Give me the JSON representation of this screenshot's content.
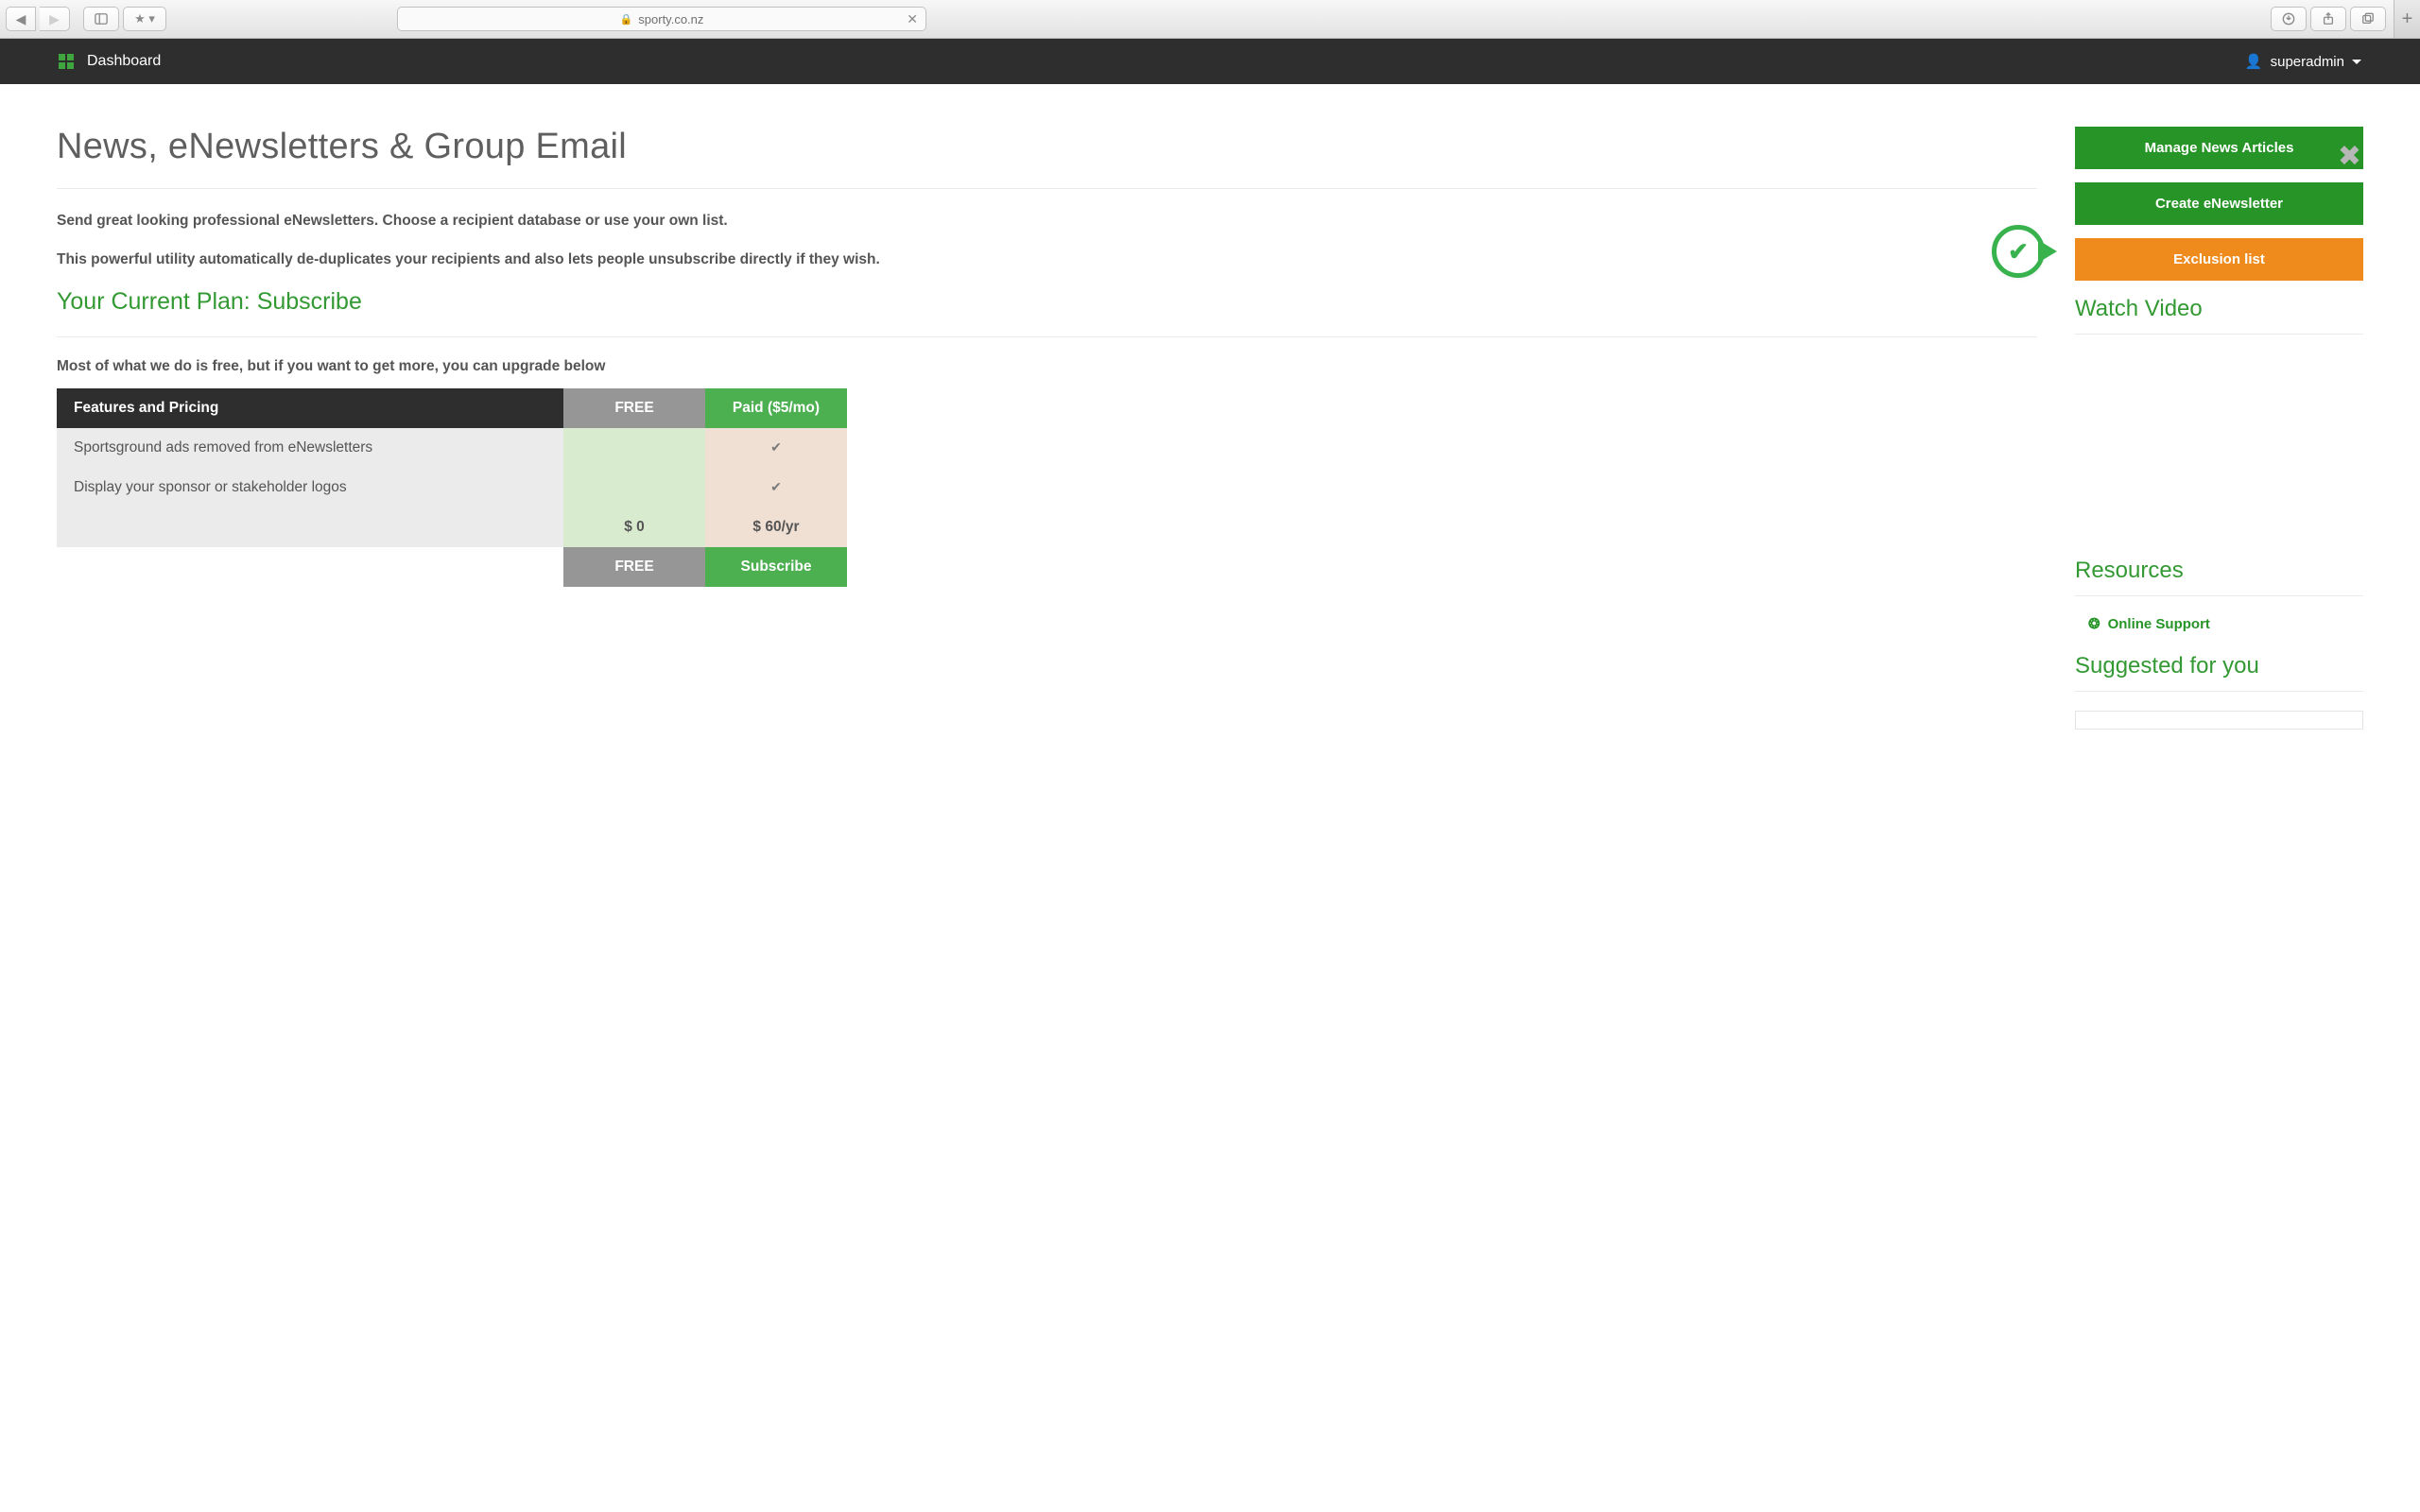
{
  "browser": {
    "url_host": "sporty.co.nz"
  },
  "nav": {
    "dashboard": "Dashboard",
    "username": "superadmin"
  },
  "page": {
    "title": "News, eNewsletters & Group Email",
    "intro1": "Send great looking professional eNewsletters. Choose a recipient database or use your own list.",
    "intro2": "This powerful utility automatically de-duplicates your recipients and also lets people unsubscribe directly if they wish.",
    "plan_heading": "Your Current Plan: Subscribe",
    "upgrade_note": "Most of what we do is free, but if you want to get more, you can upgrade below"
  },
  "pricing": {
    "header_feature": "Features and Pricing",
    "header_free": "FREE",
    "header_paid": "Paid ($5/mo)",
    "rows": [
      {
        "feature": "Sportsground ads removed from eNewsletters"
      },
      {
        "feature": "Display your sponsor or stakeholder logos"
      }
    ],
    "totals": {
      "free": "$ 0",
      "paid": "$ 60/yr"
    },
    "actions": {
      "free": "FREE",
      "paid": "Subscribe"
    }
  },
  "sidebar": {
    "buttons": {
      "manage": "Manage News Articles",
      "create": "Create eNewsletter",
      "exclusion": "Exclusion list"
    },
    "watch_video": "Watch Video",
    "resources": "Resources",
    "online_support": "Online Support",
    "suggested": "Suggested for you"
  }
}
